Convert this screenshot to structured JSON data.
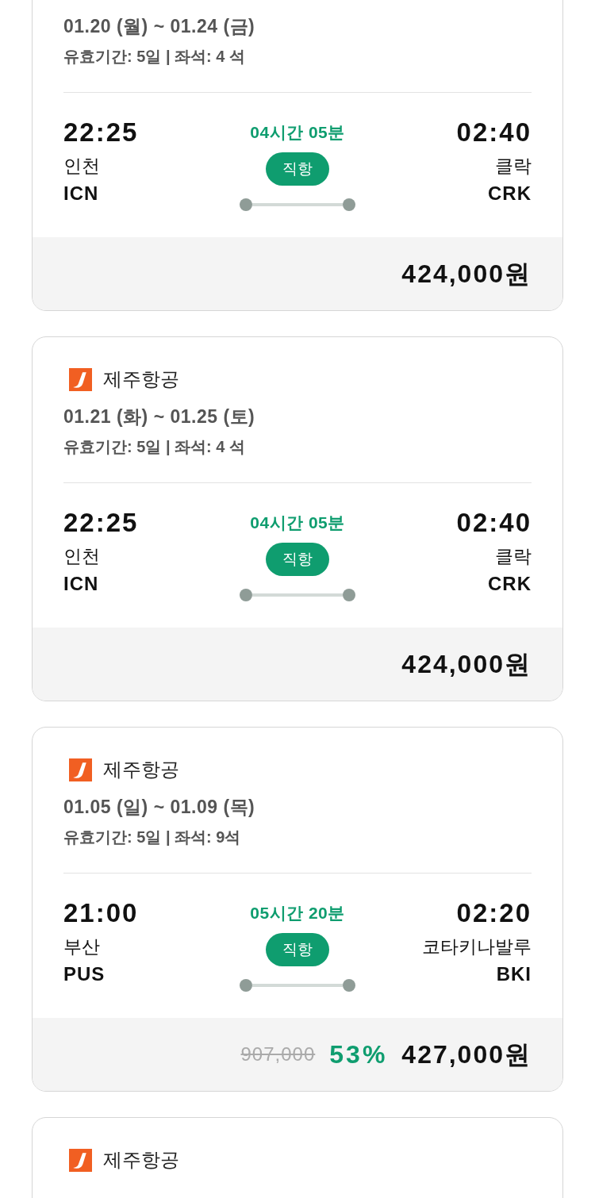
{
  "cards": [
    {
      "dates": "01.20 (월) ~ 01.24 (금)",
      "info": "유효기간: 5일 | 좌석: 4 석",
      "departure": {
        "time": "22:25",
        "city": "인천",
        "code": "ICN"
      },
      "duration": "04시간 05분",
      "route_type": "직항",
      "arrival": {
        "time": "02:40",
        "city": "클락",
        "code": "CRK"
      },
      "price": {
        "final": "424,000원"
      }
    },
    {
      "airline": "제주항공",
      "dates": "01.21 (화) ~ 01.25 (토)",
      "info": "유효기간: 5일 | 좌석: 4 석",
      "departure": {
        "time": "22:25",
        "city": "인천",
        "code": "ICN"
      },
      "duration": "04시간 05분",
      "route_type": "직항",
      "arrival": {
        "time": "02:40",
        "city": "클락",
        "code": "CRK"
      },
      "price": {
        "final": "424,000원"
      }
    },
    {
      "airline": "제주항공",
      "dates": "01.05 (일) ~ 01.09 (목)",
      "info": "유효기간: 5일 | 좌석: 9석",
      "departure": {
        "time": "21:00",
        "city": "부산",
        "code": "PUS"
      },
      "duration": "05시간 20분",
      "route_type": "직항",
      "arrival": {
        "time": "02:20",
        "city": "코타키나발루",
        "code": "BKI"
      },
      "price": {
        "original": "907,000",
        "discount": "53%",
        "final": "427,000원"
      }
    },
    {
      "airline": "제주항공"
    }
  ]
}
